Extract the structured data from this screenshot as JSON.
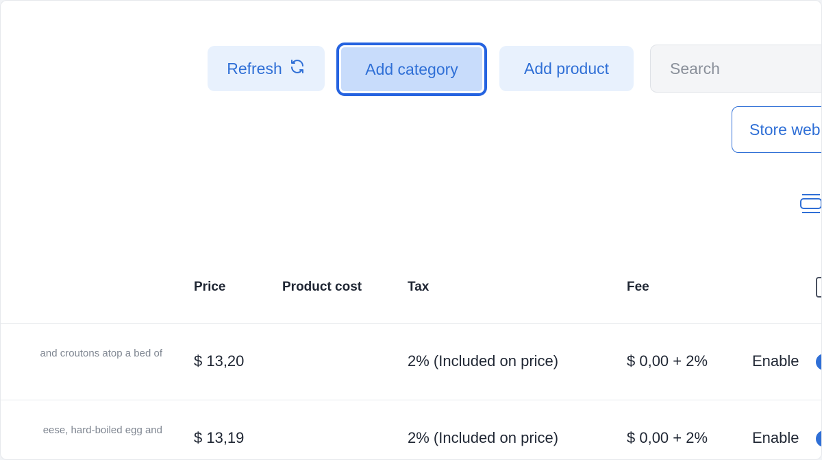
{
  "toolbar": {
    "refresh_label": "Refresh",
    "add_category_label": "Add category",
    "add_product_label": "Add product",
    "search_placeholder": "Search",
    "store_web_label": "Store web"
  },
  "table": {
    "columns": [
      "Price",
      "Product cost",
      "Tax",
      "Fee"
    ],
    "rows": [
      {
        "description": "and croutons atop a bed of",
        "price": "$ 13,20",
        "product_cost": "",
        "tax": "2% (Included on price)",
        "fee": "$ 0,00 + 2%",
        "status": "Enable"
      },
      {
        "description": "eese, hard-boiled egg and",
        "price": "$ 13,19",
        "product_cost": "",
        "tax": "2% (Included on price)",
        "fee": "$ 0,00 + 2%",
        "status": "Enable"
      }
    ]
  },
  "icons": {
    "refresh": "refresh-icon",
    "view_toggle": "layout-toggle-icon"
  },
  "colors": {
    "accent": "#2f6fd6",
    "button_bg": "#e8f1fd",
    "focused_button_bg": "#c8dcfb",
    "focus_ring": "#2563e0"
  }
}
